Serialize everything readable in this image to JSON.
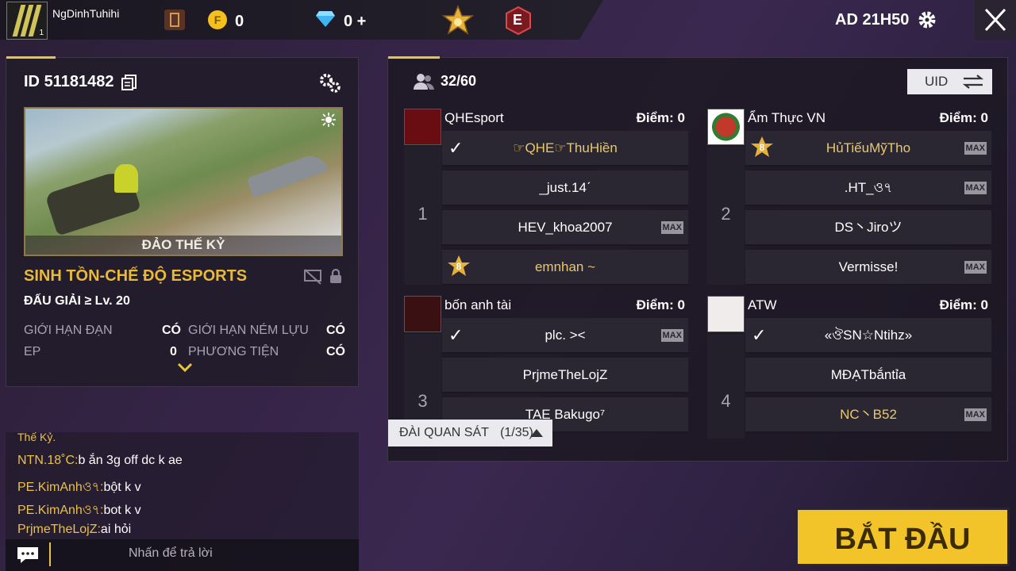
{
  "topbar": {
    "player_name": "NgDinhTuhihi",
    "level": "1",
    "gold_icon_letter": "F",
    "gold_value": "0",
    "diamond_value": "0 +",
    "rank_badge_letter": "E",
    "server_time": "AD 21H50"
  },
  "room": {
    "id_label": "ID",
    "id_value": "51181482",
    "map_name": "ĐẢO THẾ KỶ",
    "mode_title": "SINH TỒN-CHẾ ĐỘ ESPORTS",
    "tournament": "ĐẤU GIẢI ≥ Lv. 20",
    "rules": [
      {
        "label": "GIỚI HẠN ĐẠN",
        "value": "CÓ"
      },
      {
        "label": "GIỚI HẠN NÉM LỰU",
        "value": "CÓ"
      },
      {
        "label": "EP",
        "value": "0"
      },
      {
        "label": "PHƯƠNG TIỆN",
        "value": "CÓ"
      }
    ]
  },
  "lobby": {
    "player_count": "32/60",
    "uid_button": "UID",
    "teams": [
      {
        "number": "1",
        "name": "QHEsport",
        "score": "Điểm: 0",
        "slots": [
          {
            "text": "☞QHE☞ThuHiền",
            "checked": true,
            "gold": true
          },
          {
            "text": "_just.14ˊ"
          },
          {
            "text": "HEV_khoa2007",
            "max": "MAX"
          },
          {
            "text": "emnhan ~",
            "gold": true,
            "badge": "8"
          }
        ]
      },
      {
        "number": "2",
        "name": "Ẩm Thực VN",
        "score": "Điểm: 0",
        "slots": [
          {
            "text": "HủTiếuMỹTho",
            "gold": true,
            "badge": "8",
            "max": "MAX"
          },
          {
            "text": ".HT_ও৭",
            "max": "MAX"
          },
          {
            "text": "DS丶Jiroツ"
          },
          {
            "text": "Vermisse!",
            "max": "MAX"
          }
        ]
      },
      {
        "number": "3",
        "name": "bốn anh tài",
        "score": "Điểm: 0",
        "slots": [
          {
            "text": "plc. ><",
            "checked": true,
            "max": "MAX"
          },
          {
            "text": "PrjmeTheLojZ"
          },
          {
            "text": "TAE Bakugo⁷"
          }
        ]
      },
      {
        "number": "4",
        "name": "ATW",
        "score": "Điểm: 0",
        "slots": [
          {
            "text": "«ঔSN☆Ntihz»",
            "checked": true
          },
          {
            "text": "MĐẠTbắntỉa"
          },
          {
            "text": "NC丶B52",
            "gold": true,
            "max": "MAX"
          }
        ]
      }
    ],
    "spectator_label": "ĐÀI QUAN SÁT",
    "spectator_count": "(1/35)"
  },
  "chat": {
    "lines": [
      {
        "who": "Thế Kỷ.",
        "msg": ""
      },
      {
        "who": "NTN.18˚C:",
        "msg": "b ắn 3g off dc k ae"
      },
      {
        "who": "PE.KimAnhও৭:",
        "msg": "bột k v"
      },
      {
        "who": "PE.KimAnhও৭:",
        "msg": "bot k v"
      },
      {
        "who": "PrjmeTheLojZ:",
        "msg": "ai hỏi"
      }
    ],
    "reply_placeholder": "Nhấn để trả lời"
  },
  "start_button": "BẮT ĐẦU"
}
